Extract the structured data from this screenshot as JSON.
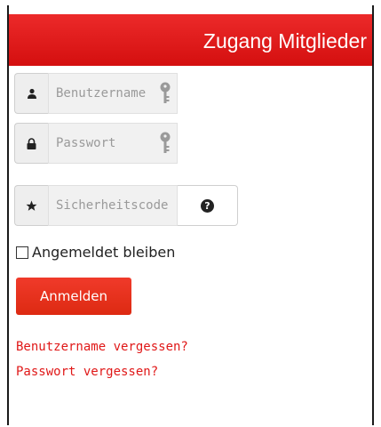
{
  "header": {
    "title": "Zugang Mitglieder"
  },
  "form": {
    "username": {
      "placeholder": "Benutzername",
      "icon": "user-icon"
    },
    "password": {
      "placeholder": "Passwort",
      "icon": "lock-icon"
    },
    "security_code": {
      "placeholder": "Sicherheitscode",
      "icon": "star-icon",
      "help_icon": "question-circle-icon"
    },
    "remember_label": "Angemeldet bleiben",
    "remember_checked": false,
    "submit_label": "Anmelden"
  },
  "links": {
    "forgot_username": "Benutzername vergessen?",
    "forgot_password": "Passwort vergessen?"
  },
  "colors": {
    "brand_red": "#e01818",
    "header_red": "#e21b1b"
  }
}
